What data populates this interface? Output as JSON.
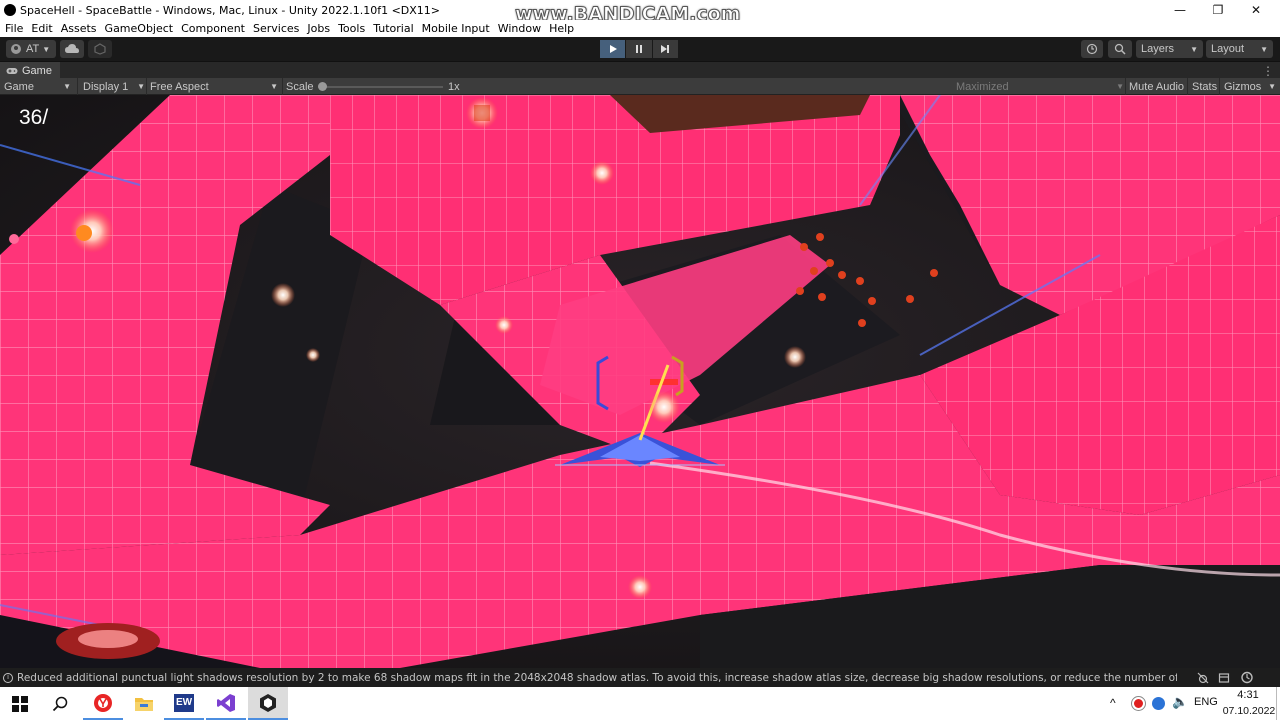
{
  "window": {
    "title": "SpaceHell - SpaceBattle - Windows, Mac, Linux - Unity 2022.1.10f1 <DX11>",
    "watermark": "www.BANDICAM.com",
    "controls": {
      "minimize": "—",
      "maximize": "❐",
      "close": "✕"
    }
  },
  "menu": [
    "File",
    "Edit",
    "Assets",
    "GameObject",
    "Component",
    "Services",
    "Jobs",
    "Tools",
    "Tutorial",
    "Mobile Input",
    "Window",
    "Help"
  ],
  "toolbar": {
    "account": "AT",
    "layers": "Layers",
    "layout": "Layout"
  },
  "tab": {
    "label": "Game"
  },
  "game_toolbar": {
    "view": "Game",
    "display": "Display 1",
    "aspect": "Free Aspect",
    "scale_label": "Scale",
    "scale_value": "1x",
    "maximized": "Maximized",
    "mute": "Mute Audio",
    "stats": "Stats",
    "gizmos": "Gizmos"
  },
  "hud": {
    "score": "36/"
  },
  "status": {
    "message": "Reduced additional punctual light shadows resolution by 2 to make 68 shadow maps fit in the 2048x2048 shadow atlas. To avoid this, increase shadow atlas size, decrease big shadow resolutions, or reduce the number of shadow maps act"
  },
  "taskbar": {
    "items": [
      "windows-start",
      "search",
      "yandex-browser",
      "file-explorer",
      "ew-app",
      "visual-studio",
      "unity"
    ],
    "ew_label": "EW",
    "lang": "ENG",
    "time": "4:31",
    "date": "07.10.2022"
  },
  "colors": {
    "neon": "#ff2f78",
    "neon_light": "#ff7aa8",
    "space": "#1e1a1e",
    "editor_dark": "#191919",
    "editor_panel": "#3c3c3c",
    "play_active": "#46607c"
  }
}
